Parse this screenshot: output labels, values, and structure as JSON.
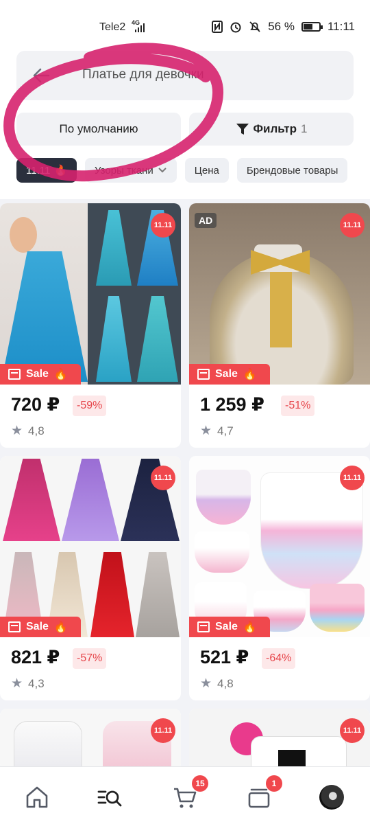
{
  "status_bar": {
    "carrier": "Tele2",
    "network": "4G",
    "battery": "56 %",
    "time": "11:11"
  },
  "search": {
    "query": "Платье для девочки"
  },
  "sort": {
    "label": "По умолчанию"
  },
  "filter": {
    "label": "Фильтр",
    "count": "1"
  },
  "chips": [
    {
      "label": "11.11"
    },
    {
      "label": "Узоры ткани"
    },
    {
      "label": "Цена"
    },
    {
      "label": "Брендовые товары"
    }
  ],
  "products": [
    {
      "badge": "11.11",
      "sale": "Sale",
      "price": "720 ₽",
      "discount": "-59%",
      "rating": "4,8",
      "ad": ""
    },
    {
      "badge": "11.11",
      "sale": "Sale",
      "price": "1 259 ₽",
      "discount": "-51%",
      "rating": "4,7",
      "ad": "AD"
    },
    {
      "badge": "11.11",
      "sale": "Sale",
      "price": "821 ₽",
      "discount": "-57%",
      "rating": "4,3",
      "ad": ""
    },
    {
      "badge": "11.11",
      "sale": "Sale",
      "price": "521 ₽",
      "discount": "-64%",
      "rating": "4,8",
      "ad": ""
    },
    {
      "badge": "11.11"
    },
    {
      "badge": "11.11"
    }
  ],
  "nav": {
    "cart_count": "15",
    "orders_count": "1"
  },
  "colors": {
    "accent": "#f0484d",
    "dark_chip": "#2a2f3d",
    "scribble": "#d6226e"
  }
}
